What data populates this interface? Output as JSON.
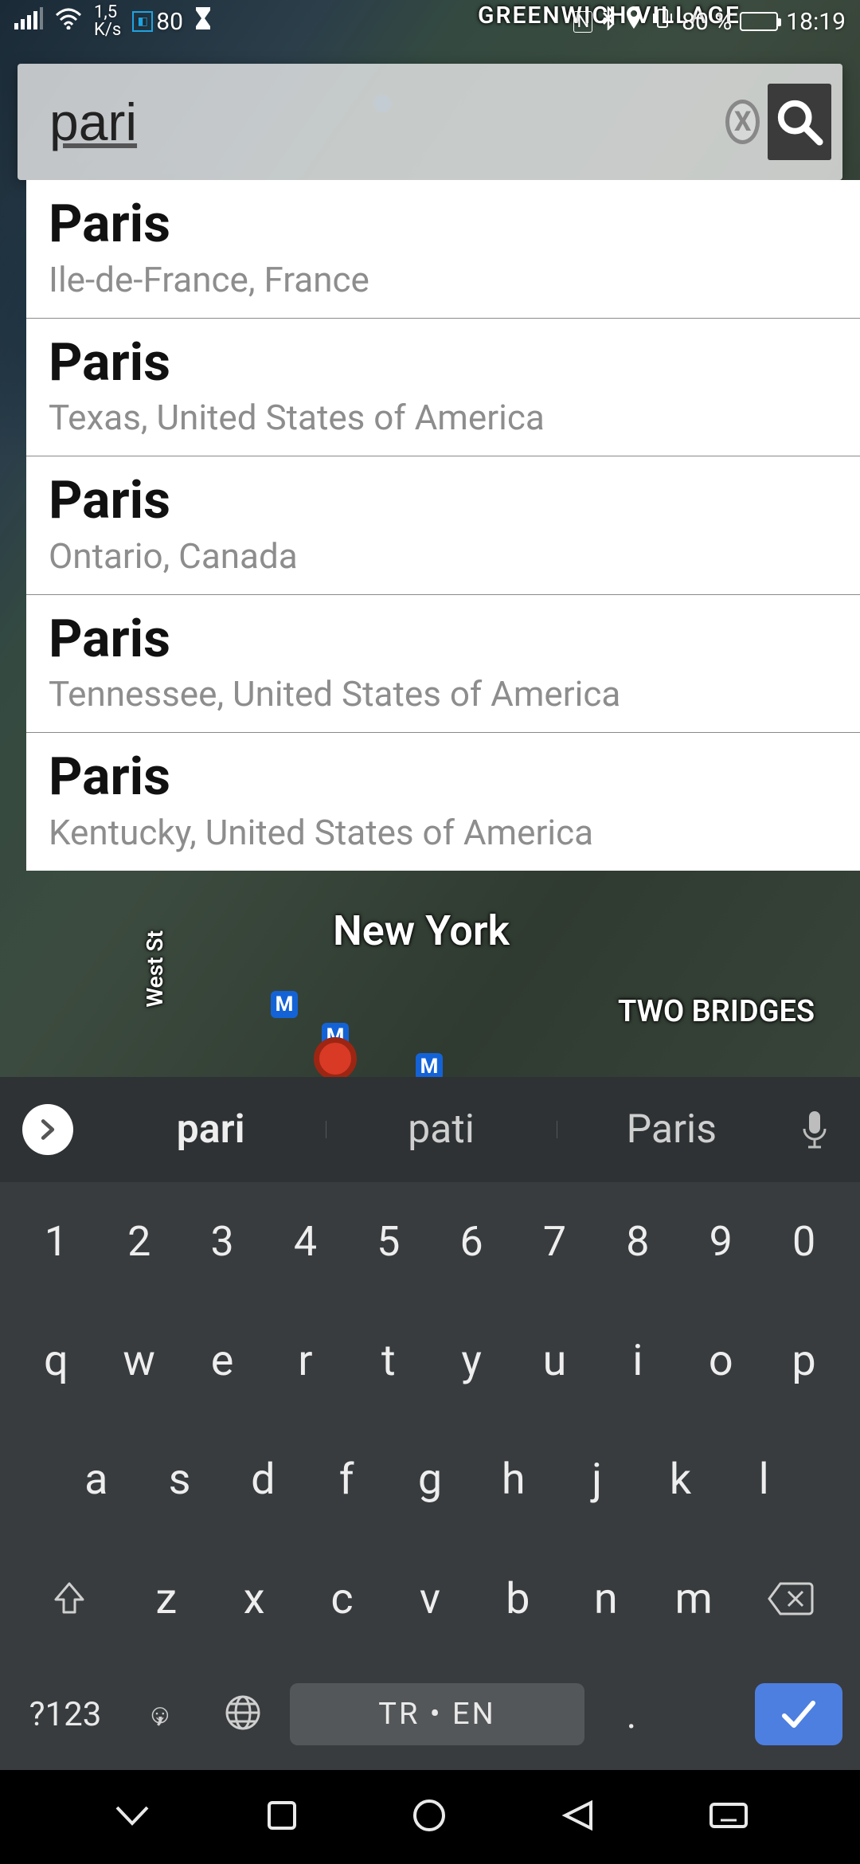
{
  "status": {
    "net_speed": "1,5",
    "net_unit": "K/s",
    "stat_num": "80",
    "battery_pct": "80 %",
    "time": "18:19"
  },
  "map": {
    "label_greenwich": "GREENWICH\nVILLAGE",
    "label_newyork": "New York",
    "label_twobridges": "TWO BRIDGES",
    "label_westst": "West St",
    "metro_glyph": "M"
  },
  "search": {
    "query": "pari",
    "clear_glyph": "X"
  },
  "suggestions": [
    {
      "title": "Paris",
      "sub": "Ile-de-France, France"
    },
    {
      "title": "Paris",
      "sub": "Texas, United States of America"
    },
    {
      "title": "Paris",
      "sub": "Ontario, Canada"
    },
    {
      "title": "Paris",
      "sub": "Tennessee, United States of America"
    },
    {
      "title": "Paris",
      "sub": "Kentucky, United States of America"
    }
  ],
  "keyboard": {
    "sugg": [
      "pari",
      "pati",
      "Paris"
    ],
    "row_num": [
      "1",
      "2",
      "3",
      "4",
      "5",
      "6",
      "7",
      "8",
      "9",
      "0"
    ],
    "row1": [
      "q",
      "w",
      "e",
      "r",
      "t",
      "y",
      "u",
      "i",
      "o",
      "p"
    ],
    "row2": [
      "a",
      "s",
      "d",
      "f",
      "g",
      "h",
      "j",
      "k",
      "l"
    ],
    "row3": [
      "z",
      "x",
      "c",
      "v",
      "b",
      "n",
      "m"
    ],
    "sym": "?123",
    "lang": "TR • EN",
    "comma": ",",
    "dot": "."
  }
}
